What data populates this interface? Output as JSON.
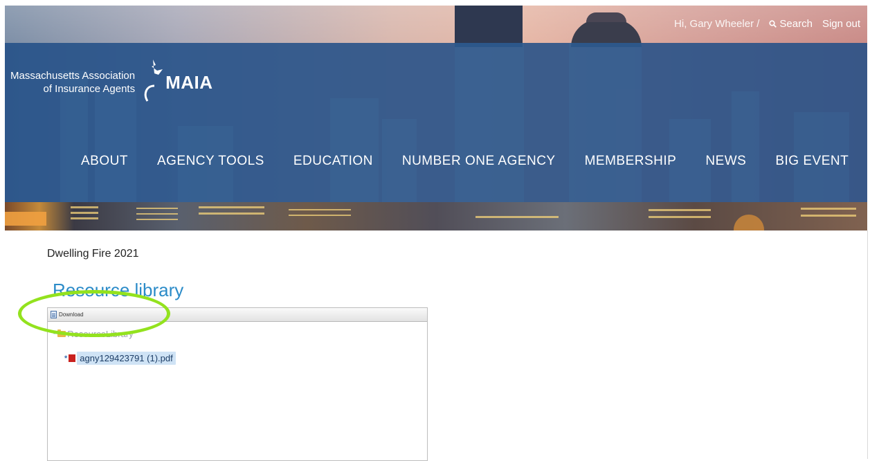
{
  "header": {
    "greeting": "Hi, Gary Wheeler /",
    "search_label": "Search",
    "signout_label": "Sign out",
    "logo": {
      "line1": "Massachusetts Association",
      "line2": "of Insurance Agents",
      "wordmark": "MAIA"
    },
    "nav": [
      "ABOUT",
      "AGENCY TOOLS",
      "EDUCATION",
      "NUMBER ONE AGENCY",
      "MEMBERSHIP",
      "NEWS",
      "BIG EVENT"
    ]
  },
  "main": {
    "page_heading": "Dwelling Fire 2021",
    "section_title": "Resource library",
    "toolbar": {
      "download_label": "Download"
    },
    "tree": {
      "root_label": "ResourceLibrary",
      "expander": "*",
      "file_name": "agny129423791 (1).pdf",
      "file_expander": "*"
    }
  },
  "colors": {
    "nav_band": "#235087",
    "section_title": "#2b8bc8",
    "highlight_oval": "#93e21e",
    "pdf_icon": "#c9211e",
    "selection": "#cfe3f5"
  },
  "icons": {
    "search": "search-icon",
    "download": "download-icon",
    "folder": "folder-icon",
    "pdf": "pdf-icon",
    "logo_bird": "eagle-logo-icon"
  }
}
